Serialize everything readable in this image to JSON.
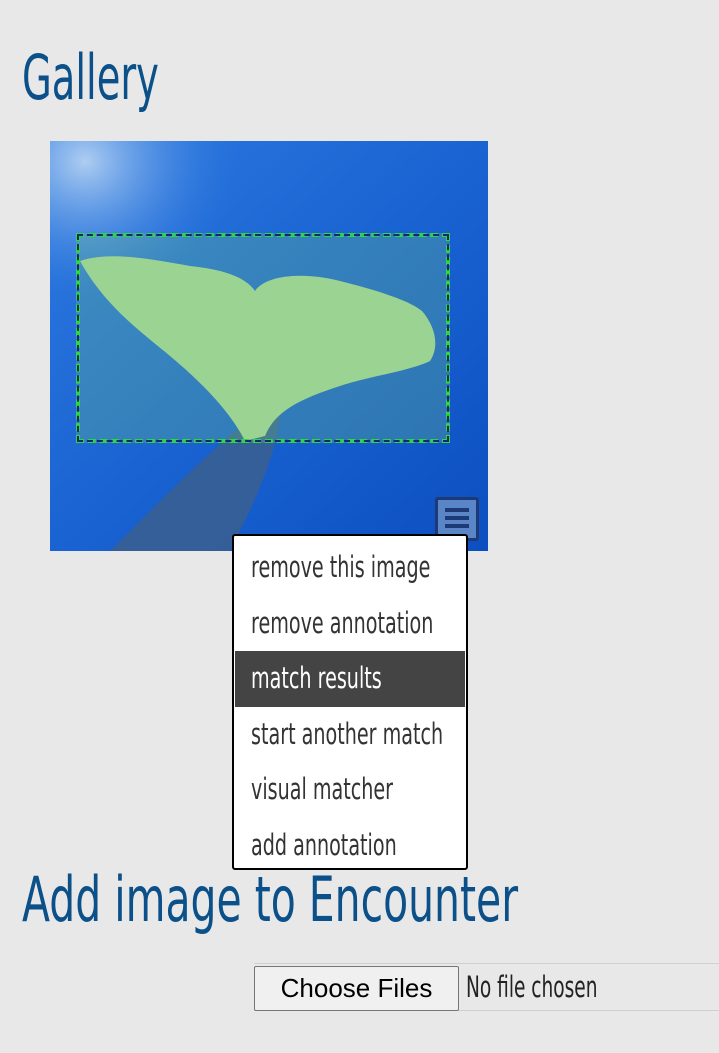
{
  "gallery": {
    "heading": "Gallery",
    "image_subject": "whale-fluke-photo",
    "menu_icon": "hamburger-menu-icon"
  },
  "context_menu": {
    "items": [
      {
        "label": "remove this image",
        "active": false
      },
      {
        "label": "remove annotation",
        "active": false
      },
      {
        "label": "match results",
        "active": true
      },
      {
        "label": "start another match",
        "active": false
      },
      {
        "label": "visual matcher",
        "active": false
      },
      {
        "label": "add annotation",
        "active": false
      }
    ]
  },
  "add_image": {
    "heading": "Add image to Encounter",
    "choose_button_label": "Choose Files",
    "file_status": "No file chosen"
  },
  "colors": {
    "heading": "#0b5088",
    "background": "#e8e8e8",
    "menu_active_bg": "#444444",
    "annotation_border": "#2fd44a"
  }
}
